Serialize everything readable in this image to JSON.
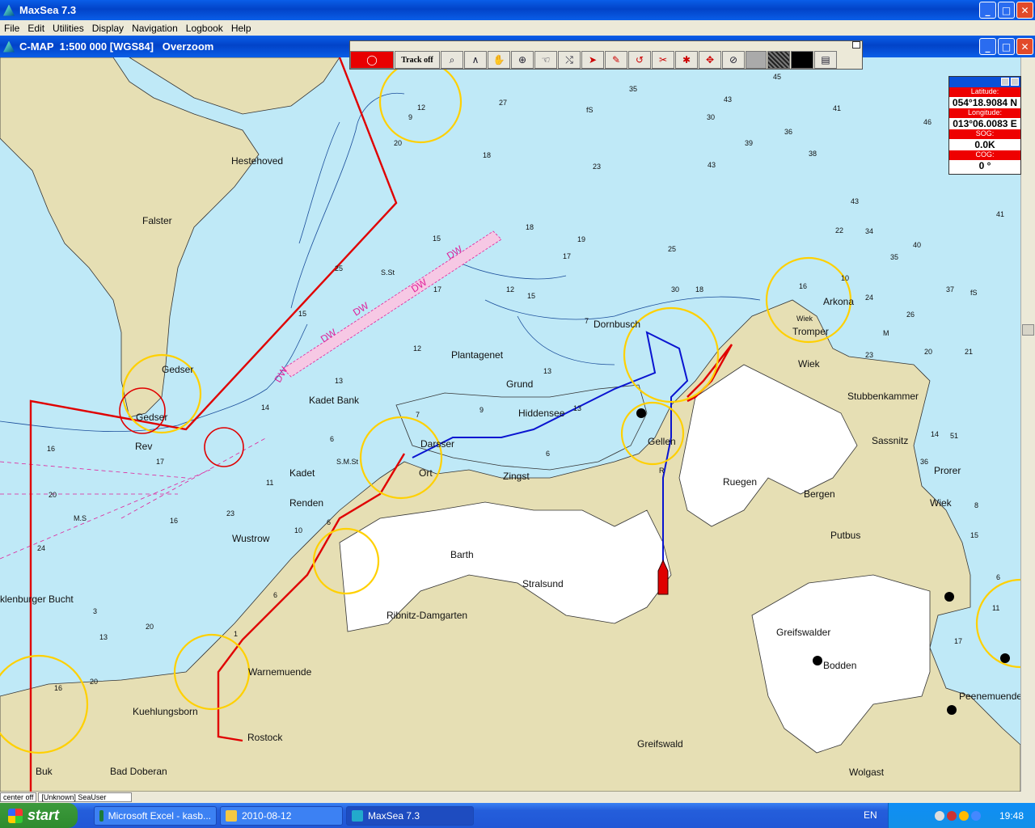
{
  "app": {
    "title": "MaxSea 7.3",
    "menu": [
      "File",
      "Edit",
      "Utilities",
      "Display",
      "Navigation",
      "Logbook",
      "Help"
    ]
  },
  "doc": {
    "title": "C-MAP  1:500 000 [WGS84]   Overzoom"
  },
  "toolbar": {
    "track_label": "Track off",
    "tools": [
      "zoom-icon",
      "compass-icon",
      "grab-hand-icon",
      "crosshair-icon",
      "pan-hand-icon",
      "route-icon",
      "pointer-icon",
      "pencil-icon",
      "undo-icon",
      "cut-icon",
      "mark-icon",
      "move-icon",
      "circle-icon"
    ]
  },
  "position": {
    "lat_label": "Latitude:",
    "lat": "054°18.9084 N",
    "lon_label": "Longitude:",
    "lon": "013°06.0083 E",
    "sog_label": "SOG:",
    "sog": "0.0K",
    "cog_label": "COG:",
    "cog": "0 °"
  },
  "status": {
    "left": "center off",
    "mid": "[Unknown]  SeaUser"
  },
  "map": {
    "places": [
      "Falster",
      "Hestehoved",
      "Gedser",
      "Gedser",
      "Rev",
      "Kadet Bank",
      "Kadet",
      "Renden",
      "Wustrow",
      "Plantagenet",
      "Grund",
      "Hiddensee",
      "Darsser",
      "Ort",
      "Zingst",
      "Barth",
      "Stralsund",
      "Ribnitz-Damgarten",
      "Dornbusch",
      "Gellen",
      "Ruegen",
      "Bergen",
      "Putbus",
      "Arkona",
      "Tromper",
      "Wiek",
      "Stubbenkammer",
      "Sassnitz",
      "Prorer",
      "Wiek",
      "Greifswalder",
      "Bodden",
      "Greifswald",
      "Peenemuende",
      "Wolgast",
      "Warnemuende",
      "Rostock",
      "Kuehlungsborn",
      "Bad Doberan",
      "Buk",
      "klenburger Bucht"
    ],
    "lane_labels": [
      "DW",
      "DW",
      "DW",
      "DW",
      "DW"
    ],
    "depths": [
      "35",
      "45",
      "27",
      "fS",
      "43",
      "41",
      "30",
      "46",
      "36",
      "39",
      "38",
      "18",
      "23",
      "43",
      "12",
      "9",
      "20",
      "43",
      "41",
      "18",
      "15",
      "25",
      "19",
      "17",
      "22",
      "34",
      "40",
      "35",
      "37",
      "fS",
      "30",
      "18",
      "16",
      "10",
      "24",
      "12",
      "17",
      "15",
      "7",
      "M",
      "26",
      "20",
      "21",
      "23",
      "Wiek",
      "14",
      "15",
      "25",
      "12",
      "13",
      "6",
      "7",
      "9",
      "13",
      "S.St",
      "6",
      "S.M.St",
      "13",
      "16",
      "17",
      "20",
      "24",
      "M.S",
      "16",
      "23",
      "11",
      "10",
      "6",
      "6",
      "1",
      "3",
      "20",
      "13",
      "16",
      "20",
      "36",
      "51",
      "11",
      "17",
      "14",
      "8",
      "15",
      "R",
      "6"
    ]
  },
  "taskbar": {
    "start": "start",
    "tasks": [
      "Microsoft Excel - kasb...",
      "2010-08-12",
      "MaxSea 7.3"
    ],
    "lang": "EN",
    "clock": "19:48"
  },
  "colors": {
    "land": "#e6dfb4",
    "shallow": "#bfe9f7",
    "deep": "#ffffff",
    "route": "#e00000",
    "track": "#0a14d0",
    "light_sector": "#ffd000",
    "lane": "#e0209a"
  }
}
